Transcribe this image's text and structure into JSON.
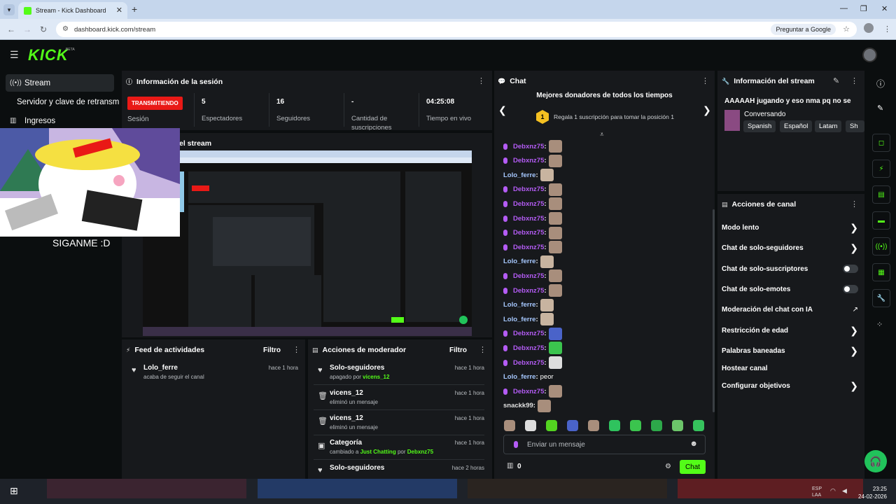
{
  "browser": {
    "tab_title": "Stream - Kick Dashboard",
    "url": "dashboard.kick.com/stream",
    "ask_google": "Preguntar a Google"
  },
  "header": {
    "logo": "KICK",
    "beta": "BETA"
  },
  "sidebar": {
    "items": [
      {
        "label": "Stream",
        "icon": "broadcast-icon"
      },
      {
        "label": "Servidor y clave de retransmisión",
        "icon": ""
      },
      {
        "label": "Ingresos",
        "icon": "chart-icon"
      }
    ]
  },
  "session": {
    "title": "Información de la sesión",
    "live_badge": "TRANSMITIENDO",
    "session_label": "Sesión",
    "stats": [
      {
        "value": "5",
        "label": "Espectadores"
      },
      {
        "value": "16",
        "label": "Seguidores"
      },
      {
        "value": "-",
        "label": "Cantidad de suscripciones"
      },
      {
        "value": "04:25:08",
        "label": "Tiempo en vivo"
      }
    ]
  },
  "preview": {
    "title": "el stream",
    "overlay_text": "SIGANME :D"
  },
  "activity_feed": {
    "title": "Feed de actividades",
    "filter": "Filtro",
    "items": [
      {
        "name": "Lolo_ferre",
        "sub": "acaba de seguir el canal",
        "time": "hace 1 hora",
        "icon": "heart-icon"
      }
    ]
  },
  "mod_actions": {
    "title": "Acciones de moderador",
    "filter": "Filtro",
    "items": [
      {
        "name": "Solo-seguidores",
        "sub_pre": "apagado por",
        "sub_user": "vicens_12",
        "time": "hace 1 hora",
        "icon": "heart-icon"
      },
      {
        "name": "vicens_12",
        "sub_pre": "eliminó un mensaje",
        "time": "hace 1 hora",
        "icon": "trash-icon"
      },
      {
        "name": "vicens_12",
        "sub_pre": "eliminó un mensaje",
        "time": "hace 1 hora",
        "icon": "trash-icon"
      },
      {
        "name": "Categoría",
        "sub_pre": "cambiado a",
        "sub_cat": "Just Chatting",
        "sub_mid": "por",
        "sub_user": "Debxnz75",
        "time": "hace 1 hora",
        "icon": "category-icon"
      },
      {
        "name": "Solo-seguidores",
        "sub_pre": "",
        "time": "hace 2 horas",
        "icon": "heart-icon"
      }
    ]
  },
  "chat": {
    "title": "Chat",
    "top_donors_title": "Mejores donadores de todos los tiempos",
    "donor_rank": "1",
    "donor_text": "Regala 1 suscripción para tomar la posición 1",
    "messages": [
      {
        "user": "Debxnz75",
        "color": "#b45cf5",
        "text": ""
      },
      {
        "user": "Debxnz75",
        "color": "#b45cf5",
        "text": ""
      },
      {
        "user": "Lolo_ferre",
        "color": "#a6c8ff",
        "text": ""
      },
      {
        "user": "Debxnz75",
        "color": "#b45cf5",
        "text": ""
      },
      {
        "user": "Debxnz75",
        "color": "#b45cf5",
        "text": ""
      },
      {
        "user": "Debxnz75",
        "color": "#b45cf5",
        "text": ""
      },
      {
        "user": "Debxnz75",
        "color": "#b45cf5",
        "text": ""
      },
      {
        "user": "Debxnz75",
        "color": "#b45cf5",
        "text": ""
      },
      {
        "user": "Lolo_ferre",
        "color": "#a6c8ff",
        "text": ""
      },
      {
        "user": "Debxnz75",
        "color": "#b45cf5",
        "text": ""
      },
      {
        "user": "Debxnz75",
        "color": "#b45cf5",
        "text": ""
      },
      {
        "user": "Lolo_ferre",
        "color": "#a6c8ff",
        "text": ""
      },
      {
        "user": "Lolo_ferre",
        "color": "#a6c8ff",
        "text": ""
      },
      {
        "user": "Debxnz75",
        "color": "#b45cf5",
        "text": ""
      },
      {
        "user": "Debxnz75",
        "color": "#b45cf5",
        "text": ""
      },
      {
        "user": "Debxnz75",
        "color": "#b45cf5",
        "text": ""
      },
      {
        "user": "Lolo_ferre",
        "color": "#a6c8ff",
        "text": "peor"
      },
      {
        "user": "Debxnz75",
        "color": "#b45cf5",
        "text": ""
      },
      {
        "user": "snackk99",
        "color": "#e0e0e0",
        "text": ""
      }
    ],
    "input_placeholder": "Enviar un mensaje",
    "points": "0",
    "send_label": "Chat"
  },
  "stream_info": {
    "title": "Información del stream",
    "stream_title": "AAAAAH jugando y eso nma pq no se",
    "category": "Conversando",
    "tags": [
      "Spanish",
      "Español",
      "Latam",
      "Sh"
    ]
  },
  "channel_actions": {
    "title": "Acciones de canal",
    "items": [
      {
        "label": "Modo lento",
        "control": "chevron"
      },
      {
        "label": "Chat de solo-seguidores",
        "control": "chevron"
      },
      {
        "label": "Chat de solo-suscriptores",
        "control": "toggle"
      },
      {
        "label": "Chat de solo-emotes",
        "control": "toggle"
      },
      {
        "label": "Moderación del chat con IA",
        "control": "external"
      },
      {
        "label": "Restricción de edad",
        "control": "chevron"
      },
      {
        "label": "Palabras baneadas",
        "control": "chevron"
      },
      {
        "label": "Hostear canal",
        "control": "none"
      },
      {
        "label": "Configurar objetivos",
        "control": "chevron"
      }
    ]
  },
  "taskbar": {
    "lang": "ESP",
    "layout": "LAA",
    "time": "23:25",
    "date": "24-02-2026"
  },
  "colors": {
    "kick_green": "#53fc18",
    "live_red": "#e91916",
    "panel": "#17191c",
    "bg": "#0b0e0f"
  }
}
